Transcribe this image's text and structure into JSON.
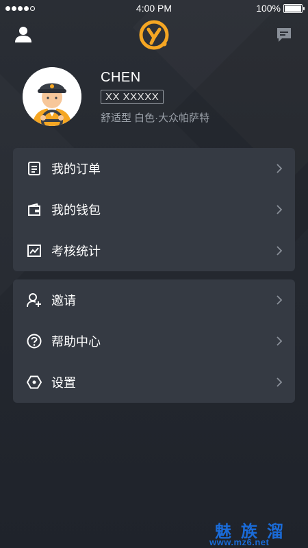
{
  "status_bar": {
    "time": "4:00 PM",
    "battery_text": "100%",
    "battery_level": 1.0,
    "signal_bars_filled": 4,
    "signal_bars_total": 5
  },
  "nav": {
    "user_icon": "user-icon",
    "logo_icon": "app-logo-icon",
    "message_icon": "message-icon"
  },
  "profile": {
    "name": "CHEN",
    "plate": "XX XXXXX",
    "car_info": "舒适型 白色·大众帕萨特"
  },
  "menu_group_1": [
    {
      "label": "我的订单",
      "icon": "order-icon"
    },
    {
      "label": "我的钱包",
      "icon": "wallet-icon"
    },
    {
      "label": "考核统计",
      "icon": "stats-icon"
    }
  ],
  "menu_group_2": [
    {
      "label": "邀请",
      "icon": "invite-icon"
    },
    {
      "label": "帮助中心",
      "icon": "help-icon"
    },
    {
      "label": "设置",
      "icon": "settings-icon"
    }
  ],
  "watermark": {
    "title": "魅族溜",
    "url": "www.mz6.net"
  },
  "colors": {
    "background": "#252930",
    "card": "#353a43",
    "accent": "#f5a623",
    "watermark": "#1a6bd8",
    "secondary_text": "#9aa0a8"
  }
}
